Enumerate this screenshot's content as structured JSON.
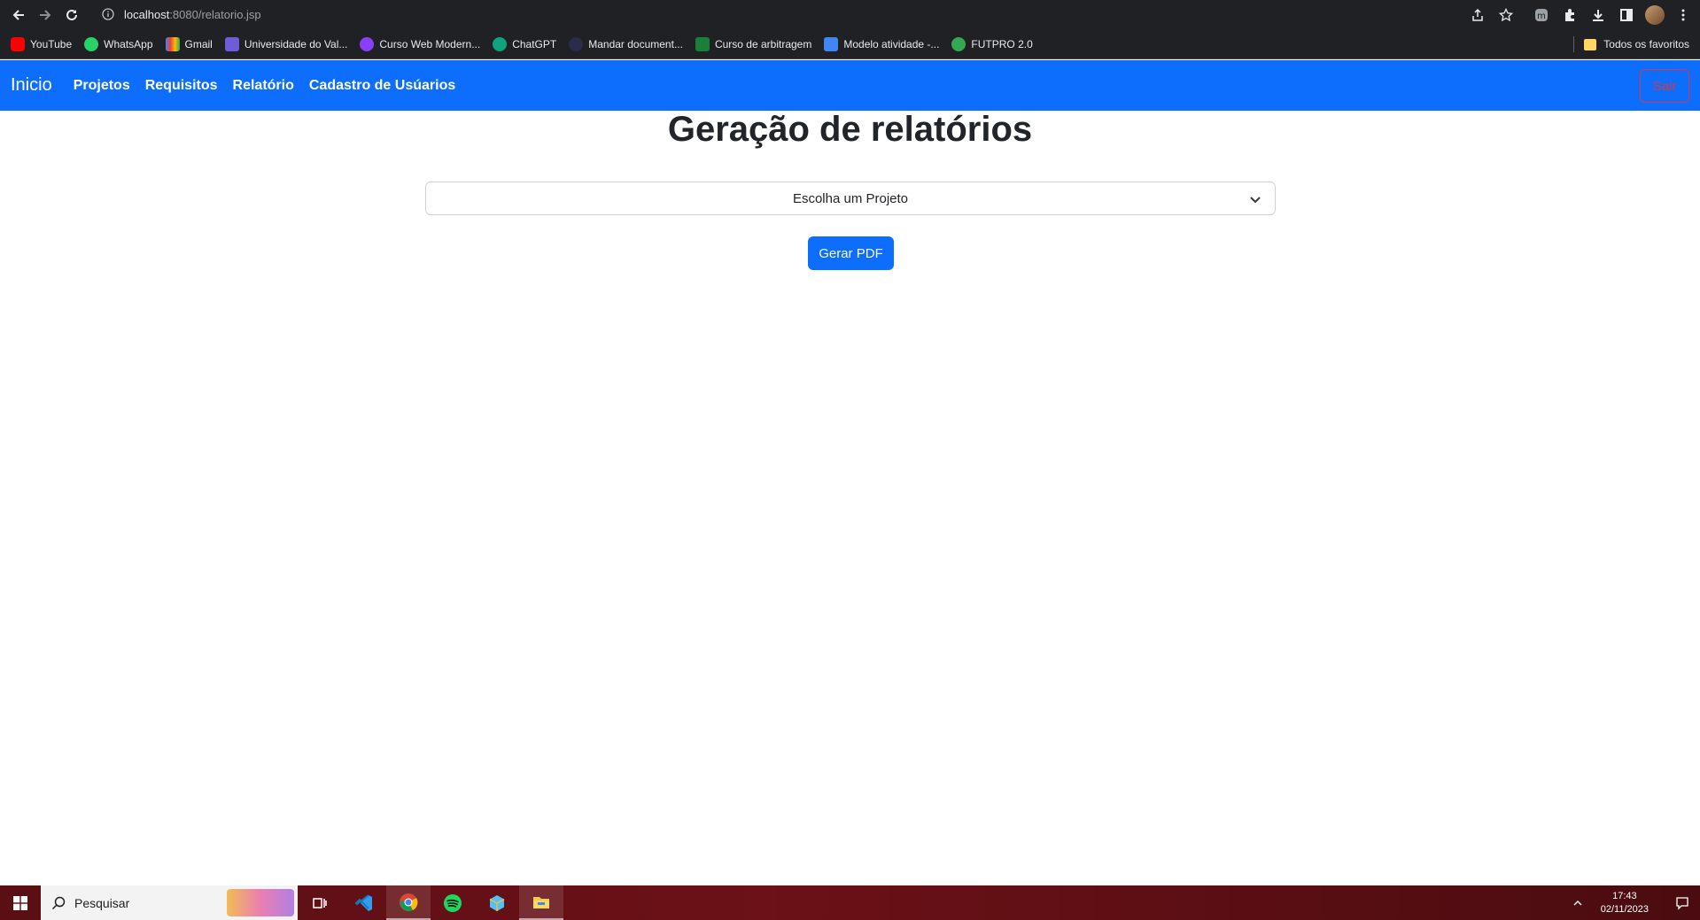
{
  "browser": {
    "url_host": "localhost",
    "url_path": ":8080/relatorio.jsp",
    "bookmarks": [
      {
        "label": "YouTube",
        "color": "#ff0000"
      },
      {
        "label": "WhatsApp",
        "color": "#25d366"
      },
      {
        "label": "Gmail",
        "color": "#ea4335"
      },
      {
        "label": "Universidade do Val...",
        "color": "#6f5cd6"
      },
      {
        "label": "Curso Web Modern...",
        "color": "#8a3ffc"
      },
      {
        "label": "ChatGPT",
        "color": "#10a37f"
      },
      {
        "label": "Mandar document...",
        "color": "#1a1a2e"
      },
      {
        "label": "Curso de arbitragem",
        "color": "#188038"
      },
      {
        "label": "Modelo atividade -...",
        "color": "#4285f4"
      },
      {
        "label": "FUTPRO 2.0",
        "color": "#34a853"
      }
    ],
    "all_bookmarks": "Todos os favoritos"
  },
  "navbar": {
    "brand": "Inicio",
    "links": [
      "Projetos",
      "Requisitos",
      "Relatório",
      "Cadastro de Usúarios"
    ],
    "logout": "Sair",
    "accent": "#0d6efd",
    "logout_color": "#dc3545"
  },
  "main": {
    "title": "Geração de relatórios",
    "select_placeholder": "Escolha um Projeto",
    "button": "Gerar PDF"
  },
  "taskbar": {
    "search_placeholder": "Pesquisar",
    "time": "17:43",
    "date": "02/11/2023"
  }
}
